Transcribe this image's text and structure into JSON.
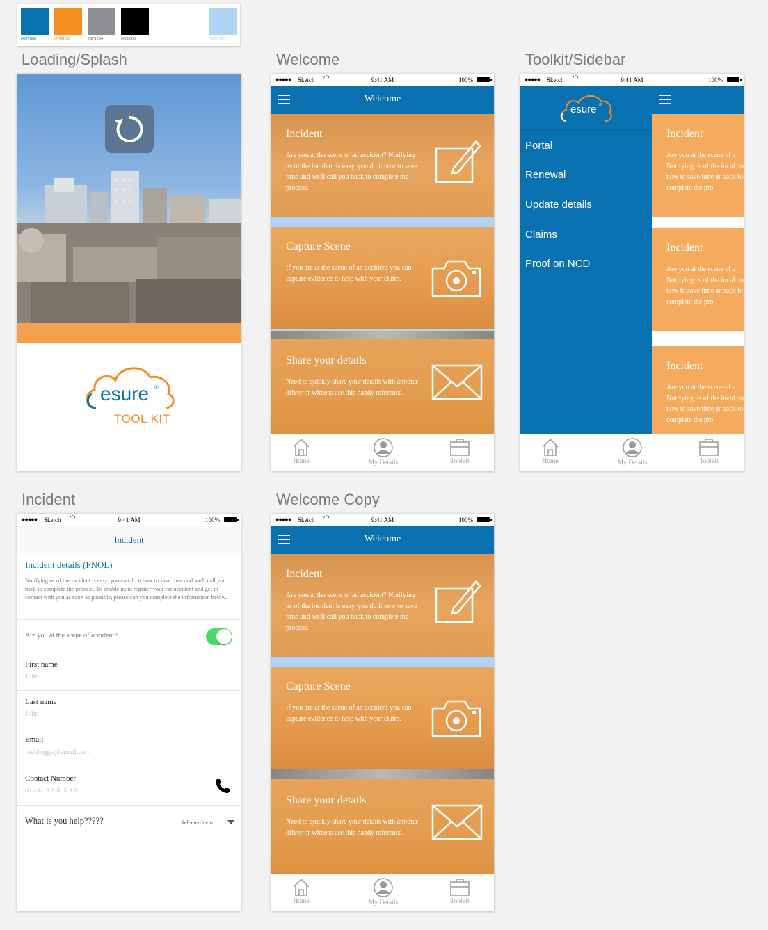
{
  "palette": [
    {
      "color": "#0971B0",
      "label": "#0971B0"
    },
    {
      "color": "#F48E1E",
      "label": "#F48E1E"
    },
    {
      "color": "#8F8E94",
      "label": "#8F8E94"
    },
    {
      "color": "#000000",
      "label": "#000000"
    },
    {
      "color": "#B0D4F6",
      "label": "#B0D4F6"
    }
  ],
  "artboards": {
    "splash": "Loading/Splash",
    "welcome": "Welcome",
    "sidebar": "Toolkit/Sidebar",
    "incident": "Incident",
    "welcome_copy": "Welcome Copy"
  },
  "statusbar": {
    "dots": "●●●●●",
    "carrier": "Sketch",
    "time": "9:41 AM",
    "battery": "100%"
  },
  "splash": {
    "logo_text": "esure",
    "logo_reg": "®",
    "tagline": "TOOL KIT"
  },
  "welcome": {
    "title": "Welcome",
    "cards": [
      {
        "title": "Incident",
        "body": "Are you at the scene of an accident? Notifying us of the incident is easy, you do it now to save time and we'll call you back to complete the process.",
        "icon": "edit-icon"
      },
      {
        "title": "Capture Scene",
        "body": "If you are at the scene of an accident  you can capture evidence to help with your claim.",
        "icon": "camera-icon"
      },
      {
        "title": "Share your details",
        "body": "Need to quickly share your details with another driver or witness use this handy reference.",
        "icon": "envelope-icon"
      }
    ]
  },
  "tabs": [
    {
      "label": "Home",
      "icon": "home-icon"
    },
    {
      "label": "My Details",
      "icon": "user-icon"
    },
    {
      "label": "Toolkit",
      "icon": "toolkit-icon"
    }
  ],
  "sidebar": {
    "logo_text": "esure",
    "logo_reg": "®",
    "menu": [
      "Portal",
      "Renewal",
      "Update details",
      "Claims",
      "Proof on NCD"
    ],
    "peek_cards": [
      {
        "title": "Incident",
        "body": "Are you at the scene of a Notifying us of the incid do it now to save time ar back to complete the pro"
      },
      {
        "title": "Incident",
        "body": "Are you at the scene of a Notifying us of the incid do it now to save time ar back to complete the pro"
      },
      {
        "title": "Incident",
        "body": "Are you at the scene of a Notifying us of the incid do it now to save time ar back to complete the pro"
      }
    ]
  },
  "incident": {
    "title": "Incident",
    "nav_right": "Done",
    "section_title": "Incident details (FNOL)",
    "intro": "Notifying us of the incident is easy, you can do it now to save time and we'll call you back to complete the process. To enable us to register your car accident and get in contact with you as soon as possible, please can you complete the information below.",
    "toggle_label": "Are you at the scene of accident?",
    "toggle_on": true,
    "fields": [
      {
        "label": "First name",
        "placeholder": "John"
      },
      {
        "label": "Last name",
        "placeholder": "John"
      },
      {
        "label": "Email",
        "placeholder": "joebloggs@email.com"
      },
      {
        "label": "Contact Number",
        "placeholder": "01737 XXX XXX"
      }
    ],
    "select_label": "What is you help?????",
    "select_value": "Selected item"
  }
}
